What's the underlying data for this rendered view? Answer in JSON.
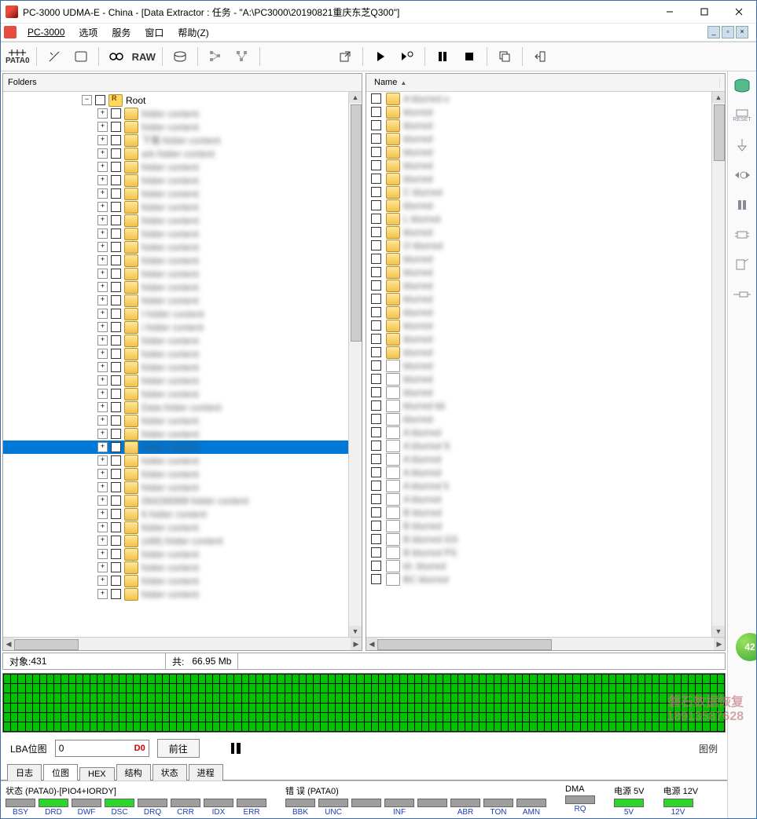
{
  "window": {
    "title": "PC-3000 UDMA-E - China - [Data Extractor : 任务 - \"A:\\PC3000\\20190821重庆东芝Q300\"]"
  },
  "menubar": {
    "items": [
      "PC-3000",
      "选项",
      "服务",
      "窗口",
      "帮助(Z)"
    ]
  },
  "toolbar": {
    "pata_label": "PATA0",
    "raw_label": "RAW"
  },
  "left_panel": {
    "header": "Folders",
    "root_label": "Root",
    "items": [
      {
        "label": "",
        "blur": true
      },
      {
        "label": "",
        "blur": true
      },
      {
        "label": "下载",
        "blur": true
      },
      {
        "label": "ark",
        "blur": true
      },
      {
        "label": "",
        "blur": true
      },
      {
        "label": "",
        "blur": true
      },
      {
        "label": "",
        "blur": true
      },
      {
        "label": "",
        "blur": true
      },
      {
        "label": "",
        "blur": true
      },
      {
        "label": "",
        "blur": true
      },
      {
        "label": "",
        "blur": true
      },
      {
        "label": "",
        "blur": true
      },
      {
        "label": "",
        "blur": true
      },
      {
        "label": "",
        "blur": true
      },
      {
        "label": "",
        "blur": true
      },
      {
        "label": "I",
        "blur": true
      },
      {
        "label": "i",
        "blur": true
      },
      {
        "label": "",
        "blur": true
      },
      {
        "label": "",
        "blur": true
      },
      {
        "label": "",
        "blur": true
      },
      {
        "label": "",
        "blur": true
      },
      {
        "label": "",
        "blur": true
      },
      {
        "label": "Data",
        "blur": true
      },
      {
        "label": "",
        "blur": true
      },
      {
        "label": "",
        "blur": true
      },
      {
        "label": "",
        "blur": true,
        "selected": true
      },
      {
        "label": "",
        "blur": true
      },
      {
        "label": "",
        "blur": true
      },
      {
        "label": "",
        "blur": true
      },
      {
        "label": "094266989",
        "blur": true
      },
      {
        "label": "6",
        "blur": true
      },
      {
        "label": "",
        "blur": true
      },
      {
        "label": "(x86)",
        "blur": true
      },
      {
        "label": "",
        "blur": true
      },
      {
        "label": "",
        "blur": true
      },
      {
        "label": "",
        "blur": true
      },
      {
        "label": "",
        "blur": true
      }
    ]
  },
  "right_panel": {
    "header": "Name",
    "items": [
      {
        "icon": "folder",
        "label": "A",
        "blur": true,
        "suffix": "o"
      },
      {
        "icon": "folder",
        "label": "",
        "blur": true
      },
      {
        "icon": "folder",
        "label": "",
        "blur": true
      },
      {
        "icon": "folder",
        "label": "",
        "blur": true
      },
      {
        "icon": "folder",
        "label": "",
        "blur": true
      },
      {
        "icon": "folder",
        "label": "",
        "blur": true
      },
      {
        "icon": "folder",
        "label": "",
        "blur": true
      },
      {
        "icon": "folder",
        "label": "C",
        "blur": true
      },
      {
        "icon": "folder",
        "label": "",
        "blur": true
      },
      {
        "icon": "folder",
        "label": "L",
        "blur": true
      },
      {
        "icon": "folder",
        "label": "",
        "blur": true
      },
      {
        "icon": "folder",
        "label": "O",
        "blur": true
      },
      {
        "icon": "folder",
        "label": "",
        "blur": true
      },
      {
        "icon": "folder",
        "label": "",
        "blur": true
      },
      {
        "icon": "folder",
        "label": "",
        "blur": true
      },
      {
        "icon": "folder",
        "label": "",
        "blur": true
      },
      {
        "icon": "folder",
        "label": "",
        "blur": true
      },
      {
        "icon": "folder",
        "label": "",
        "blur": true
      },
      {
        "icon": "folder",
        "label": "",
        "blur": true
      },
      {
        "icon": "folder",
        "label": "",
        "blur": true
      },
      {
        "icon": "file",
        "label": "",
        "blur": true
      },
      {
        "icon": "file",
        "label": "",
        "blur": true
      },
      {
        "icon": "file",
        "label": "",
        "blur": true
      },
      {
        "icon": "file",
        "label": "",
        "blur": true,
        "suffix": "ild"
      },
      {
        "icon": "file",
        "label": "",
        "blur": true
      },
      {
        "icon": "file",
        "label": "A",
        "blur": true
      },
      {
        "icon": "file",
        "label": "A",
        "blur": true,
        "suffix": "S"
      },
      {
        "icon": "file",
        "label": "A",
        "blur": true
      },
      {
        "icon": "file",
        "label": "A",
        "blur": true
      },
      {
        "icon": "file",
        "label": "A",
        "blur": true,
        "suffix": "5"
      },
      {
        "icon": "file",
        "label": "A",
        "blur": true
      },
      {
        "icon": "file",
        "label": "B",
        "blur": true
      },
      {
        "icon": "file",
        "label": "B",
        "blur": true
      },
      {
        "icon": "file",
        "label": "B",
        "blur": true,
        "suffix": "GS"
      },
      {
        "icon": "file",
        "label": "B",
        "blur": true,
        "suffix": "PS"
      },
      {
        "icon": "file",
        "label": "bf.",
        "blur": true
      },
      {
        "icon": "file",
        "label": "BC",
        "blur": true
      }
    ]
  },
  "info": {
    "objects_label": "对象:",
    "objects_value": "431",
    "total_label": "共:",
    "total_value": "66.95 Mb"
  },
  "lba": {
    "label": "LBA位图",
    "value": "0",
    "marker": "D0",
    "go_label": "前往",
    "legend_label": "图例"
  },
  "tabs": [
    "日志",
    "位图",
    "HEX",
    "结构",
    "状态",
    "进程"
  ],
  "active_tab": 1,
  "status": {
    "pata_title": "状态 (PATA0)-[PIO4+IORDY]",
    "pata_leds": [
      {
        "name": "BSY",
        "on": false
      },
      {
        "name": "DRD",
        "on": true
      },
      {
        "name": "DWF",
        "on": false
      },
      {
        "name": "DSC",
        "on": true
      },
      {
        "name": "DRQ",
        "on": false
      },
      {
        "name": "CRR",
        "on": false
      },
      {
        "name": "IDX",
        "on": false
      },
      {
        "name": "ERR",
        "on": false
      }
    ],
    "err_title": "错 误 (PATA0)",
    "err_leds": [
      {
        "name": "BBK",
        "on": false
      },
      {
        "name": "UNC",
        "on": false
      },
      {
        "name": "",
        "on": false
      },
      {
        "name": "INF",
        "on": false
      },
      {
        "name": "",
        "on": false
      },
      {
        "name": "ABR",
        "on": false
      },
      {
        "name": "TON",
        "on": false
      },
      {
        "name": "AMN",
        "on": false
      }
    ],
    "dma_title": "DMA",
    "dma_leds": [
      {
        "name": "RQ",
        "on": false
      }
    ],
    "pwr5_title": "电源 5V",
    "pwr5_leds": [
      {
        "name": "5V",
        "on": true
      }
    ],
    "pwr12_title": "电源 12V",
    "pwr12_leds": [
      {
        "name": "12V",
        "on": true
      }
    ]
  },
  "watermark": {
    "line1": "磐石数据恢复",
    "line2": "18913587628"
  },
  "badge": "42"
}
